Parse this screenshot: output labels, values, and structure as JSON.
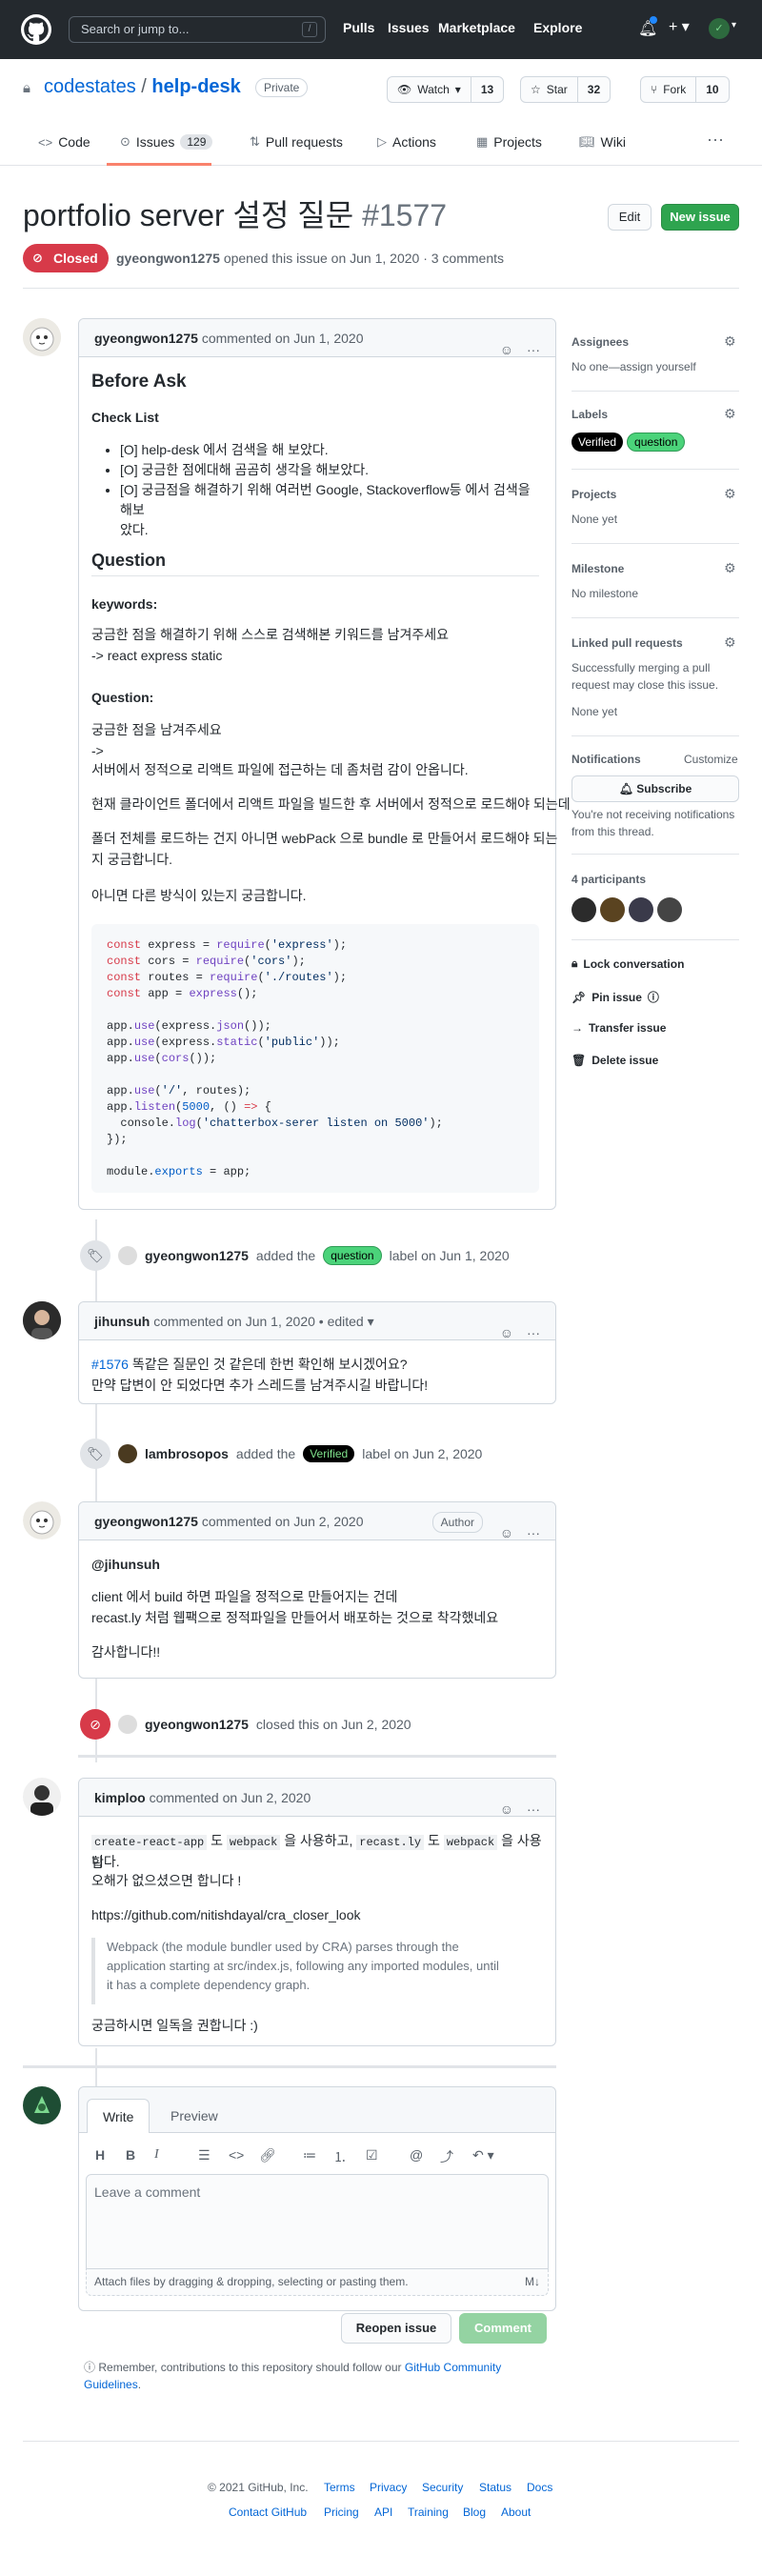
{
  "header": {
    "search_placeholder": "Search or jump to...",
    "slash_key": "/",
    "nav": [
      "Pulls",
      "Issues",
      "Marketplace",
      "Explore"
    ]
  },
  "repo": {
    "owner": "codestates",
    "separator": "/",
    "name": "help-desk",
    "visibility": "Private",
    "watch_label": "Watch",
    "watch_count": "13",
    "star_label": "Star",
    "star_count": "32",
    "fork_label": "Fork",
    "fork_count": "10"
  },
  "tabs": {
    "code": "Code",
    "issues": "Issues",
    "issues_count": "129",
    "pulls": "Pull requests",
    "actions": "Actions",
    "projects": "Projects",
    "wiki": "Wiki"
  },
  "issue": {
    "title": "portfolio server 설정 질문",
    "number": "#1577",
    "edit_label": "Edit",
    "new_issue_label": "New issue",
    "state": "Closed",
    "meta_author": "gyeongwon1275",
    "meta_rest": "opened this issue on Jun 1, 2020 · 3 comments"
  },
  "comment1": {
    "author": "gyeongwon1275",
    "date": "commented on Jun 1, 2020",
    "h_before_ask": "Before Ask",
    "h_check_list": "Check List",
    "check1": "[O] help-desk 에서 검색을 해 보았다.",
    "check2": "[O] 궁금한 점에대해 곰곰히 생각을 해보았다.",
    "check3a": "[O] 궁금점을 해결하기 위해 여러번 Google, Stackoverflow등 에서 검색을 해보",
    "check3b": "았다.",
    "h_question": "Question",
    "h_keywords": "keywords:",
    "kw1": "궁금한 점을 해결하기 위해 스스로 검색해본 키워드를 남겨주세요",
    "kw2": "-> react express static",
    "h_question2": "Question:",
    "q1": "궁금한 점을 남겨주세요",
    "q2": "->",
    "q3": "서버에서 정적으로 리액트 파일에 접근하는 데 좀처럼 감이 안옵니다.",
    "q4": "현재 클라이언트 폴더에서 리액트 파일을 빌드한 후 서버에서 정적으로 로드해야 되는데",
    "q5": "폴더 전체를 로드하는 건지 아니면 webPack 으로 bundle 로 만들어서 로드해야 되는",
    "q6": "지 궁금합니다.",
    "q7": "아니면 다른 방식이 있는지 궁금합니다."
  },
  "event1": {
    "actor": "gyeongwon1275",
    "pre": "added the",
    "label": "question",
    "post": "label on Jun 1, 2020"
  },
  "comment2": {
    "author": "jihunsuh",
    "date": "commented on Jun 1, 2020 • edited",
    "link": "#1576",
    "line1": " 똑같은 질문인 것 같은데 한번 확인해 보시겠어요?",
    "line2": "만약 답변이 안 되었다면 추가 스레드를 남겨주시길 바랍니다!"
  },
  "event2": {
    "actor": "lambrosopos",
    "pre": "added the",
    "label": "Verified",
    "post": "label on Jun 2, 2020"
  },
  "comment3": {
    "author": "gyeongwon1275",
    "date": "commented on Jun 2, 2020",
    "badge": "Author",
    "mention": "@jihunsuh",
    "line1": "client 에서 build 하면 파일을 정적으로 만들어지는 건데",
    "line2": "recast.ly 처럼 웹팩으로 정적파일을 만들어서 배포하는 것으로 착각했네요",
    "line3": "감사합니다!!"
  },
  "event3": {
    "actor": "gyeongwon1275",
    "text": "closed this on Jun 2, 2020"
  },
  "comment4": {
    "author": "kimploo",
    "date": "commented on Jun 2, 2020",
    "code1": "create-react-app",
    "t1": " 도 ",
    "code2": "webpack",
    "t2": " 을 사용하고, ",
    "code3": "recast.ly",
    "t3": " 도 ",
    "code4": "webpack",
    "t4": " 을 사용합",
    "line1b": "니다.",
    "line2": "오해가 없으셨으면 합니다 !",
    "link": "https://github.com/nitishdayal/cra_closer_look",
    "quote1": "Webpack (the module bundler used by CRA) parses through the",
    "quote2": "application starting at src/index.js, following any imported modules, until",
    "quote3": "it has a complete dependency graph.",
    "line3": "궁금하시면 일독을 권합니다 :)"
  },
  "editor": {
    "tab_write": "Write",
    "tab_preview": "Preview",
    "placeholder": "Leave a comment",
    "attach": "Attach files by dragging & dropping, selecting or pasting them.",
    "reopen": "Reopen issue",
    "comment": "Comment",
    "remember_pre": "Remember, contributions to this repository should follow our ",
    "remember_link1": "GitHub Community",
    "remember_link2": "Guidelines",
    "remember_post": "."
  },
  "sidebar": {
    "assignees_h": "Assignees",
    "assignees_v": "No one—assign yourself",
    "labels_h": "Labels",
    "label_verified": "Verified",
    "label_question": "question",
    "projects_h": "Projects",
    "projects_v": "None yet",
    "milestone_h": "Milestone",
    "milestone_v": "No milestone",
    "linked_h": "Linked pull requests",
    "linked_v1": "Successfully merging a pull",
    "linked_v2": "request may close this issue.",
    "linked_v3": "None yet",
    "notif_h": "Notifications",
    "customize": "Customize",
    "subscribe": "Subscribe",
    "notif_v1": "You're not receiving notifications",
    "notif_v2": "from this thread.",
    "participants": "4 participants",
    "lock": "Lock conversation",
    "pin": "Pin issue",
    "transfer": "Transfer issue",
    "delete": "Delete issue"
  },
  "footer": {
    "copyright": "© 2021 GitHub, Inc.",
    "row1": [
      "Terms",
      "Privacy",
      "Security",
      "Status",
      "Docs"
    ],
    "row2": [
      "Contact GitHub",
      "Pricing",
      "API",
      "Training",
      "Blog",
      "About"
    ]
  },
  "colors": {
    "header_bg": "#24292e",
    "closed_red": "#d73a49",
    "green": "#2ea44f",
    "link": "#0366d6"
  }
}
